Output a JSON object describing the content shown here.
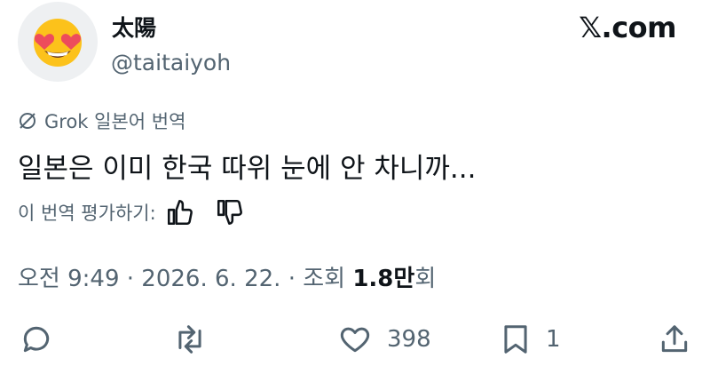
{
  "author": {
    "display_name": "太陽",
    "handle": "@taitaiyoh",
    "avatar_icon": "heart-eyes-emoji-icon"
  },
  "brand": "𝕏.com",
  "translation": {
    "label": "Grok 일본어 번역",
    "icon": "grok-icon"
  },
  "tweet": {
    "text": "일본은 이미 한국 따위 눈에 안 차니까..."
  },
  "rating": {
    "label": "이 번역 평가하기:"
  },
  "meta": {
    "time": "오전 9:49",
    "sep1": "·",
    "date": "2026. 6. 22.",
    "sep2": "·",
    "views_prefix": "조회",
    "views_count": "1.8만",
    "views_suffix": "회"
  },
  "actions": {
    "reply": {
      "icon": "reply-icon",
      "count": ""
    },
    "repost": {
      "icon": "repost-icon",
      "count": ""
    },
    "like": {
      "icon": "heart-icon",
      "count": "398"
    },
    "bookmark": {
      "icon": "bookmark-icon",
      "count": "1"
    },
    "share": {
      "icon": "share-icon",
      "count": ""
    }
  },
  "colors": {
    "text_primary": "#0f1419",
    "text_secondary": "#536471",
    "emoji_face": "#fcc21b",
    "emoji_heart": "#ed4c5c"
  }
}
